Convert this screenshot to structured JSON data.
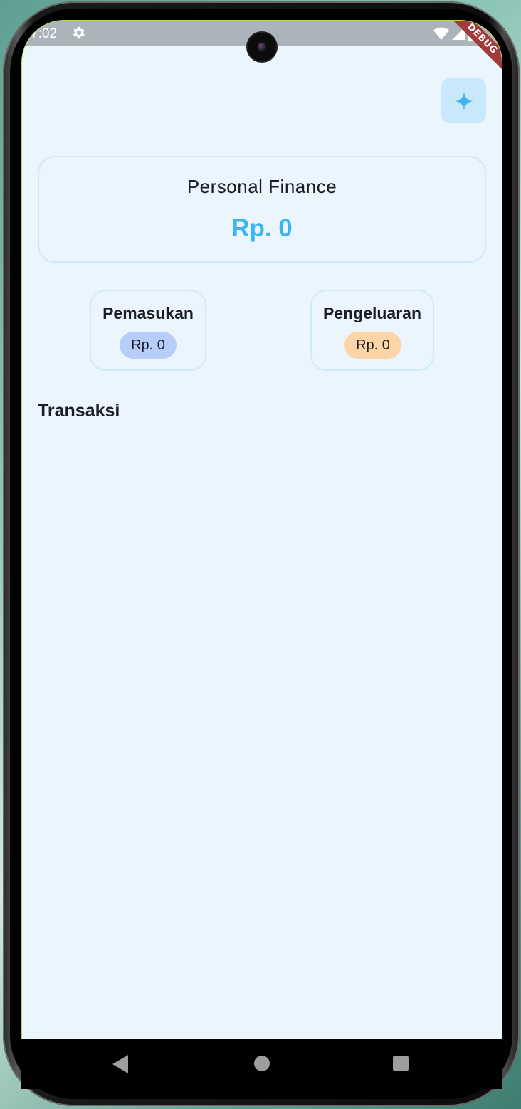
{
  "status_bar": {
    "time": "7:02",
    "debug_label": "DEBUG"
  },
  "header": {
    "action_icon": "sparkle-icon"
  },
  "summary": {
    "title": "Personal Finance",
    "amount": "Rp. 0"
  },
  "income": {
    "title": "Pemasukan",
    "amount": "Rp. 0"
  },
  "expense": {
    "title": "Pengeluaran",
    "amount": "Rp. 0"
  },
  "transactions": {
    "title": "Transaksi",
    "items": []
  },
  "colors": {
    "accent": "#3cb6f2",
    "background": "#ebf5fe",
    "income_pill": "#b7cdfa",
    "expense_pill": "#fdd4a5"
  },
  "navigation": {
    "back_icon": "back-triangle-icon",
    "home_icon": "home-circle-icon",
    "recents_icon": "recents-square-icon"
  }
}
